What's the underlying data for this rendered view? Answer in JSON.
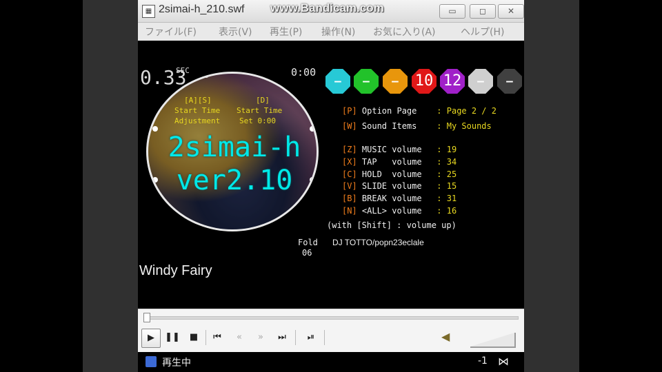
{
  "window": {
    "title": "2simai-h_210.swf",
    "watermark": "www.Bandicam.com",
    "controls": {
      "minimize": "▭",
      "maximize": "◻",
      "close": "✕"
    }
  },
  "menu": [
    {
      "label": "ファイル(F)"
    },
    {
      "label": "表示(V)"
    },
    {
      "label": "再生(P)"
    },
    {
      "label": "操作(N)"
    },
    {
      "label": "お気に入り(A)"
    },
    {
      "label": "ヘルプ(H)"
    }
  ],
  "game": {
    "timer_value": "0.33",
    "timer_unit": "SEC",
    "clock": "0:00",
    "disc": {
      "left_key": "[A][S]",
      "left_line1": "Start Time",
      "left_line2": "Adjustment",
      "right_key": "[D]",
      "right_line1": "Start Time",
      "right_line2": "Set 0:00",
      "title_line1": "2simai-h",
      "title_line2": "ver2.10"
    },
    "difficulty_buttons": [
      {
        "label": "—",
        "color": "#27c9d6"
      },
      {
        "label": "—",
        "color": "#22c22a"
      },
      {
        "label": "—",
        "color": "#e8960c"
      },
      {
        "label": "10",
        "color": "#e01818"
      },
      {
        "label": "12",
        "color": "#a020c8"
      },
      {
        "label": "—",
        "color": "#cfcfcf"
      },
      {
        "label": "—",
        "color": "#404040"
      }
    ],
    "options": [
      {
        "key": "[P]",
        "label": " Option Page",
        "value": "    : Page 2 / 2"
      },
      {
        "key": "[W]",
        "label": " Sound Items",
        "value": "    : My Sounds"
      },
      {
        "key": "[Z]",
        "label": " MUSIC volume",
        "value": "   : 19"
      },
      {
        "key": "[X]",
        "label": " TAP   volume",
        "value": "   : 34"
      },
      {
        "key": "[C]",
        "label": " HOLD  volume",
        "value": "   : 25"
      },
      {
        "key": "[V]",
        "label": " SLIDE volume",
        "value": "   : 15"
      },
      {
        "key": "[B]",
        "label": " BREAK volume",
        "value": "   : 31"
      },
      {
        "key": "[N]",
        "label": " <ALL> volume",
        "value": "   : 16"
      }
    ],
    "shift_note": "(with [Shift] : volume up)",
    "fold_label": "Fold",
    "fold_number": "06",
    "artist": "DJ TOTTO/popn23eclale",
    "song_title": "Windy Fairy"
  },
  "player": {
    "play": "▶",
    "pause": "❚❚",
    "stop": "■",
    "prev": "⏮",
    "rewind": "«",
    "forward": "»",
    "next": "⏭",
    "frame": "⏯"
  },
  "status": {
    "text": "再生中",
    "number": "-1",
    "icon": "⋈"
  }
}
